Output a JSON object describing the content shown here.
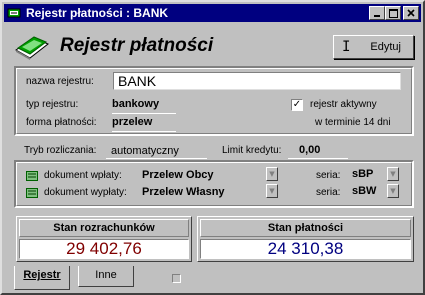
{
  "window": {
    "title": "Rejestr płatności : BANK",
    "controls": {
      "minimize": "_",
      "maximize": "□",
      "close": "×"
    }
  },
  "header": {
    "title": "Rejestr płatności",
    "edit_button": "Edytuj",
    "edit_icon": "text-cursor-icon"
  },
  "register": {
    "name_label": "nazwa rejestru:",
    "name_value": "BANK",
    "type_label": "typ rejestru:",
    "type_value": "bankowy",
    "payment_form_label": "forma płatności:",
    "payment_form_value": "przelew",
    "active_label": "rejestr aktywny",
    "active_checked": true,
    "term_text": "w terminie 14 dni"
  },
  "settlement": {
    "mode_label": "Tryb rozliczania:",
    "mode_value": "automatyczny",
    "credit_limit_label": "Limit kredytu:",
    "credit_limit_value": "0,00"
  },
  "documents": {
    "deposit_label": "dokument wpłaty:",
    "deposit_value": "Przelew Obcy",
    "deposit_series_label": "seria:",
    "deposit_series_value": "sBP",
    "withdrawal_label": "dokument wypłaty:",
    "withdrawal_value": "Przelew Własny",
    "withdrawal_series_label": "seria:",
    "withdrawal_series_value": "sBW"
  },
  "summary": {
    "balance_label": "Stan rozrachunków",
    "balance_value": "29 402,76",
    "balance_color": "#800000",
    "payments_label": "Stan płatności",
    "payments_value": "24 310,38",
    "payments_color": "#000080"
  },
  "tabs": [
    {
      "label": "Rejestr",
      "active": true
    },
    {
      "label": "Inne",
      "active": false
    }
  ]
}
